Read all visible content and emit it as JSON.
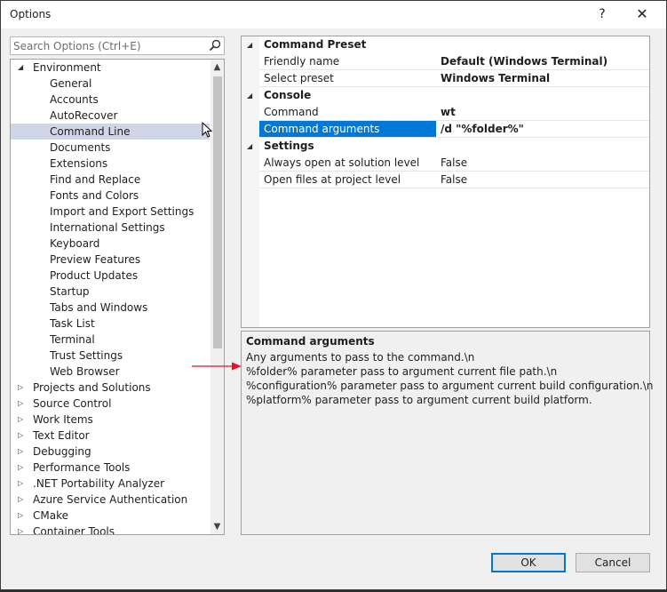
{
  "window": {
    "title": "Options",
    "help_label": "?",
    "close_label": "✕"
  },
  "search": {
    "placeholder": "Search Options (Ctrl+E)",
    "value": ""
  },
  "tree": {
    "items": [
      {
        "label": "Environment",
        "level": 0,
        "expander": "expanded"
      },
      {
        "label": "General",
        "level": 1
      },
      {
        "label": "Accounts",
        "level": 1
      },
      {
        "label": "AutoRecover",
        "level": 1
      },
      {
        "label": "Command Line",
        "level": 1,
        "selected": true
      },
      {
        "label": "Documents",
        "level": 1
      },
      {
        "label": "Extensions",
        "level": 1
      },
      {
        "label": "Find and Replace",
        "level": 1
      },
      {
        "label": "Fonts and Colors",
        "level": 1
      },
      {
        "label": "Import and Export Settings",
        "level": 1
      },
      {
        "label": "International Settings",
        "level": 1
      },
      {
        "label": "Keyboard",
        "level": 1
      },
      {
        "label": "Preview Features",
        "level": 1
      },
      {
        "label": "Product Updates",
        "level": 1
      },
      {
        "label": "Startup",
        "level": 1
      },
      {
        "label": "Tabs and Windows",
        "level": 1
      },
      {
        "label": "Task List",
        "level": 1
      },
      {
        "label": "Terminal",
        "level": 1
      },
      {
        "label": "Trust Settings",
        "level": 1
      },
      {
        "label": "Web Browser",
        "level": 1
      },
      {
        "label": "Projects and Solutions",
        "level": 0,
        "expander": "collapsed"
      },
      {
        "label": "Source Control",
        "level": 0,
        "expander": "collapsed"
      },
      {
        "label": "Work Items",
        "level": 0,
        "expander": "collapsed"
      },
      {
        "label": "Text Editor",
        "level": 0,
        "expander": "collapsed"
      },
      {
        "label": "Debugging",
        "level": 0,
        "expander": "collapsed"
      },
      {
        "label": "Performance Tools",
        "level": 0,
        "expander": "collapsed"
      },
      {
        "label": ".NET Portability Analyzer",
        "level": 0,
        "expander": "collapsed"
      },
      {
        "label": "Azure Service Authentication",
        "level": 0,
        "expander": "collapsed"
      },
      {
        "label": "CMake",
        "level": 0,
        "expander": "collapsed"
      },
      {
        "label": "Container Tools",
        "level": 0,
        "expander": "collapsed"
      }
    ]
  },
  "grid": {
    "rows": [
      {
        "type": "category",
        "label": "Command Preset"
      },
      {
        "type": "property",
        "name": "Friendly name",
        "value": "Default (Windows Terminal)",
        "bold": true
      },
      {
        "type": "property",
        "name": "Select preset",
        "value": "Windows Terminal",
        "bold": true
      },
      {
        "type": "category",
        "label": "Console"
      },
      {
        "type": "property",
        "name": "Command",
        "value": "wt",
        "bold": true
      },
      {
        "type": "property",
        "name": "Command arguments",
        "value": "/d \"%folder%\"",
        "bold": true,
        "selected": true
      },
      {
        "type": "category",
        "label": "Settings"
      },
      {
        "type": "property",
        "name": "Always open at solution level",
        "value": "False"
      },
      {
        "type": "property",
        "name": "Open files at project level",
        "value": "False"
      }
    ]
  },
  "description": {
    "title": "Command arguments",
    "lines": [
      "Any arguments to pass to the command.\\n",
      "%folder% parameter pass to argument current file path.\\n",
      "%configuration% parameter pass to argument current build configuration.\\n",
      "%platform% parameter pass to argument current build platform."
    ]
  },
  "buttons": {
    "ok_label": "OK",
    "cancel_label": "Cancel"
  },
  "colors": {
    "selection": "#0078d7",
    "tree_selection": "#cfd7e6",
    "annotation_arrow": "#e81123"
  }
}
